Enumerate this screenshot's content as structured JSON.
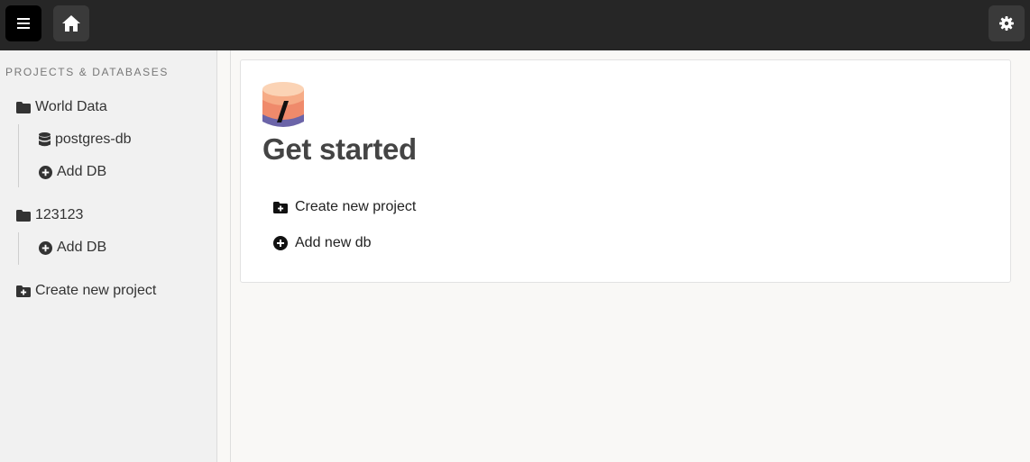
{
  "topbar": {
    "menu_icon": "hamburger-menu-icon",
    "home_icon": "home-icon",
    "settings_icon": "gear-icon"
  },
  "sidebar": {
    "heading": "PROJECTS & DATABASES",
    "projects": [
      {
        "name": "World Data",
        "icon": "folder-icon",
        "items": [
          {
            "label": "postgres-db",
            "icon": "database-icon"
          },
          {
            "label": "Add DB",
            "icon": "plus-circle-icon"
          }
        ]
      },
      {
        "name": "123123",
        "icon": "folder-icon",
        "items": [
          {
            "label": "Add DB",
            "icon": "plus-circle-icon"
          }
        ]
      }
    ],
    "create_project": {
      "label": "Create new project",
      "icon": "folder-plus-icon"
    }
  },
  "main": {
    "title": "Get started",
    "actions": [
      {
        "label": "Create new project",
        "icon": "folder-plus-icon"
      },
      {
        "label": "Add new db",
        "icon": "plus-circle-icon"
      }
    ],
    "logo": "database-logo-icon"
  },
  "colors": {
    "topbar": "#262626",
    "sidebar": "#f1f1f1",
    "background": "#f9f8f6",
    "logo_top": "#f9c7a3",
    "logo_mid": "#ef8a6b",
    "logo_bottom": "#6b64a8"
  }
}
